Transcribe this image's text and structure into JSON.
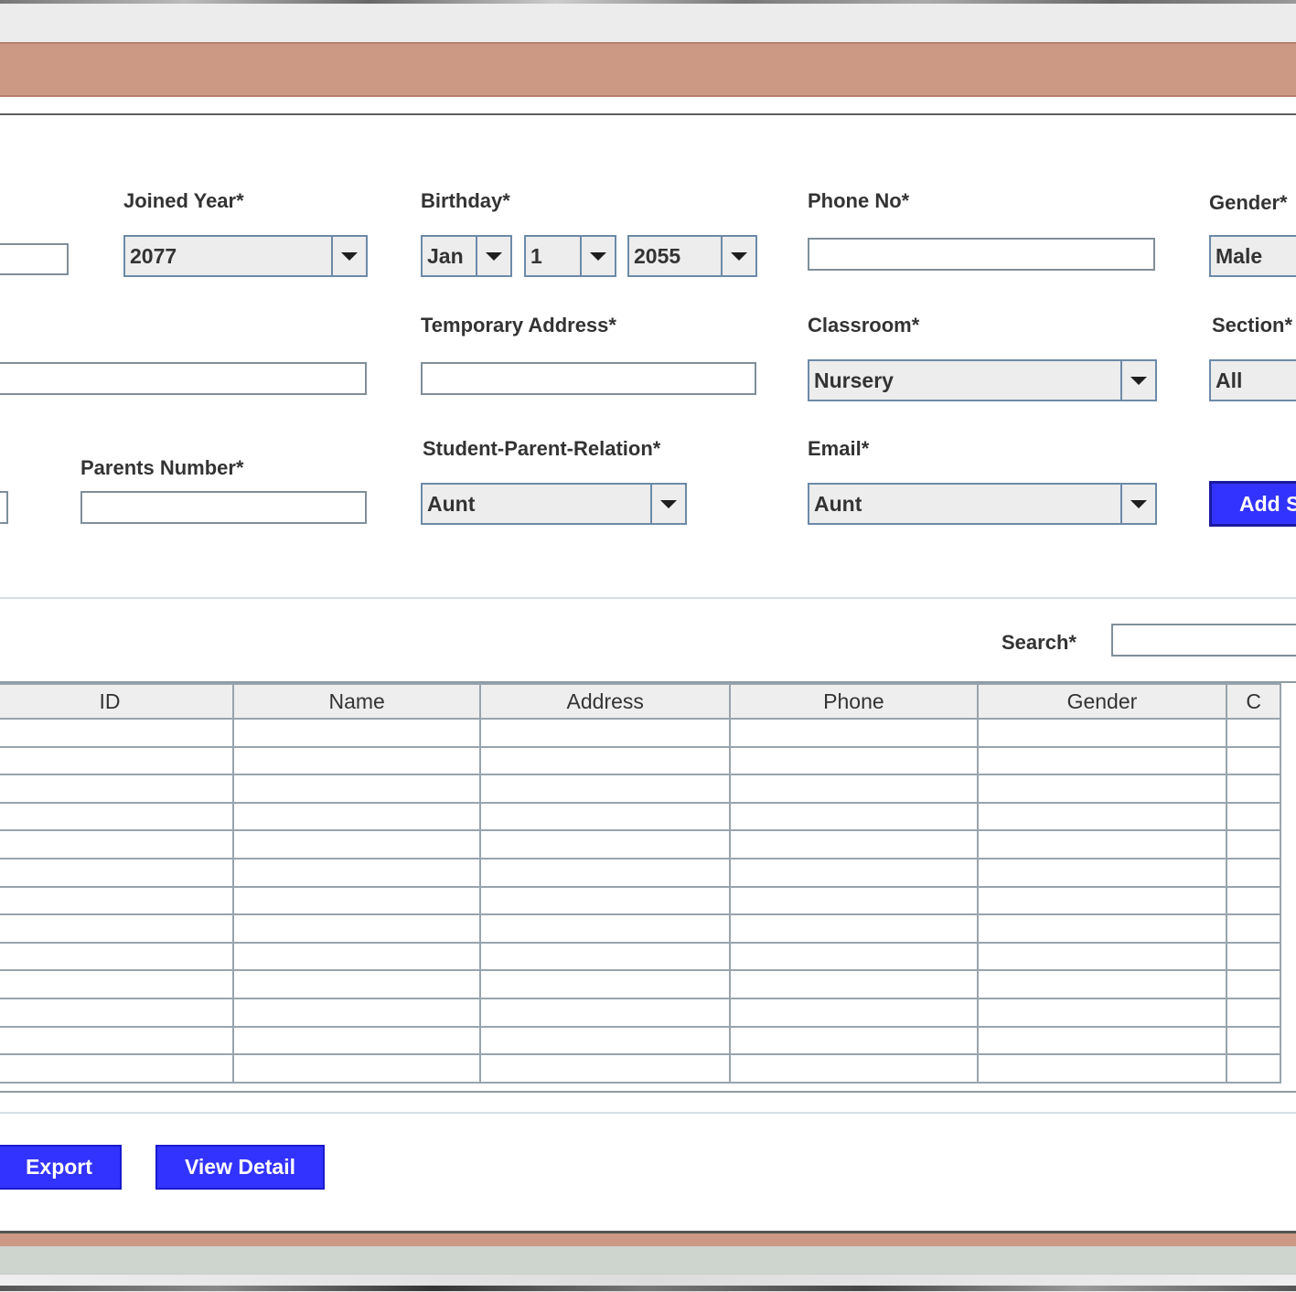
{
  "form": {
    "joined_year_label": "Joined Year*",
    "joined_year_value": "2077",
    "birthday_label": "Birthday*",
    "birthday_month": "Jan",
    "birthday_day": "1",
    "birthday_year": "2055",
    "phone_label": "Phone No*",
    "gender_label": "Gender*",
    "gender_value": "Male",
    "temp_address_label": "Temporary Address*",
    "classroom_label": "Classroom*",
    "classroom_value": "Nursery",
    "section_label": "Section*",
    "section_value": "All",
    "parents_number_label": "Parents Number*",
    "relation_label": "Student-Parent-Relation*",
    "relation_value": "Aunt",
    "email_label": "Email*",
    "email_value": "Aunt",
    "add_button": "Add S"
  },
  "search": {
    "label": "Search*"
  },
  "table": {
    "columns": [
      "ID",
      "Name",
      "Address",
      "Phone",
      "Gender",
      "C"
    ],
    "row_count": 13
  },
  "actions": {
    "export": "Export",
    "view_detail": "View Detail"
  },
  "colors": {
    "banner": "#cc9985",
    "button": "#3333ff",
    "combo_border": "#6c8aa8"
  }
}
